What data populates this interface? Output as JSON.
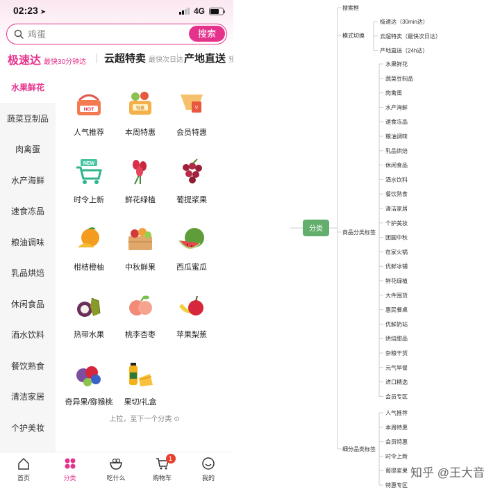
{
  "status_bar": {
    "time": "02:23",
    "network": "4G"
  },
  "search": {
    "placeholder": "鸡蛋",
    "button_label": "搜索"
  },
  "mode_tabs": [
    {
      "title": "极速达",
      "subtitle": "最快30分钟达"
    },
    {
      "title": "云超特卖",
      "subtitle": "最快次日达"
    },
    {
      "title": "产地直送",
      "subtitle": "预计"
    }
  ],
  "sidebar": {
    "items": [
      "水果鲜花",
      "蔬菜豆制品",
      "肉禽蛋",
      "水产海鲜",
      "速食冻品",
      "粮油调味",
      "乳品烘焙",
      "休闲食品",
      "酒水饮料",
      "餐饮熟食",
      "清洁家居",
      "个护美妆"
    ],
    "active_index": 0
  },
  "categories": [
    {
      "label": "人气推荐",
      "icon": "hot-basket-icon"
    },
    {
      "label": "本周特惠",
      "icon": "special-basket-icon"
    },
    {
      "label": "会员特惠",
      "icon": "vip-coupon-icon"
    },
    {
      "label": "时令上新",
      "icon": "new-cart-icon"
    },
    {
      "label": "鲜花绿植",
      "icon": "tulip-icon"
    },
    {
      "label": "葡提浆果",
      "icon": "grape-icon"
    },
    {
      "label": "柑桔橙柚",
      "icon": "orange-icon"
    },
    {
      "label": "中秋鲜果",
      "icon": "fruit-box-icon"
    },
    {
      "label": "西瓜蜜瓜",
      "icon": "melon-icon"
    },
    {
      "label": "热带水果",
      "icon": "tropical-fruit-icon"
    },
    {
      "label": "桃李杏枣",
      "icon": "peach-icon"
    },
    {
      "label": "苹果梨蕉",
      "icon": "apple-banana-icon"
    },
    {
      "label": "奇异果/猕猴桃",
      "icon": "kiwi-berry-icon"
    },
    {
      "label": "果切/礼盒",
      "icon": "juice-gift-icon"
    }
  ],
  "next_hint": "上拉，至下一个分类",
  "tabbar": [
    {
      "label": "首页",
      "icon": "home-icon"
    },
    {
      "label": "分类",
      "icon": "category-icon"
    },
    {
      "label": "吃什么",
      "icon": "bowl-icon"
    },
    {
      "label": "购物车",
      "icon": "cart-icon"
    },
    {
      "label": "我的",
      "icon": "profile-icon"
    }
  ],
  "tabbar_active_index": 1,
  "cart_badge": "1",
  "colors": {
    "accent": "#e5328b",
    "mindmap_root": "#63ad6d",
    "badge": "#e8412b"
  },
  "mindmap": {
    "root": "分类",
    "branches": [
      {
        "label": "搜索框",
        "children": []
      },
      {
        "label": "模式切换",
        "children": [
          "极速达（30min达）",
          "云超特卖（最快次日达）",
          "产地直送（24h达）"
        ]
      },
      {
        "label": "商品分类标签",
        "children": [
          "水果鲜花",
          "蔬菜豆制品",
          "肉禽蛋",
          "水产海鲜",
          "速食冻品",
          "粮油调味",
          "乳品烘焙",
          "休闲食品",
          "酒水饮料",
          "餐饮熟食",
          "清洁家居",
          "个护美妆",
          "团圆中秋",
          "在家火锅",
          "优鲜冰铺",
          "鲜花绿植",
          "大件囤货",
          "惠民餐桌",
          "优鲜奶站",
          "烘焙甜品",
          "杂粮干货",
          "元气早餐",
          "进口精选",
          "会员专区"
        ]
      },
      {
        "label": "细分品类标签",
        "children": [
          "人气推荐",
          "本周特惠",
          "会员特惠",
          "时令上新",
          "葡提浆果",
          "特惠专区"
        ]
      }
    ]
  },
  "watermark": "知乎 @王大音"
}
